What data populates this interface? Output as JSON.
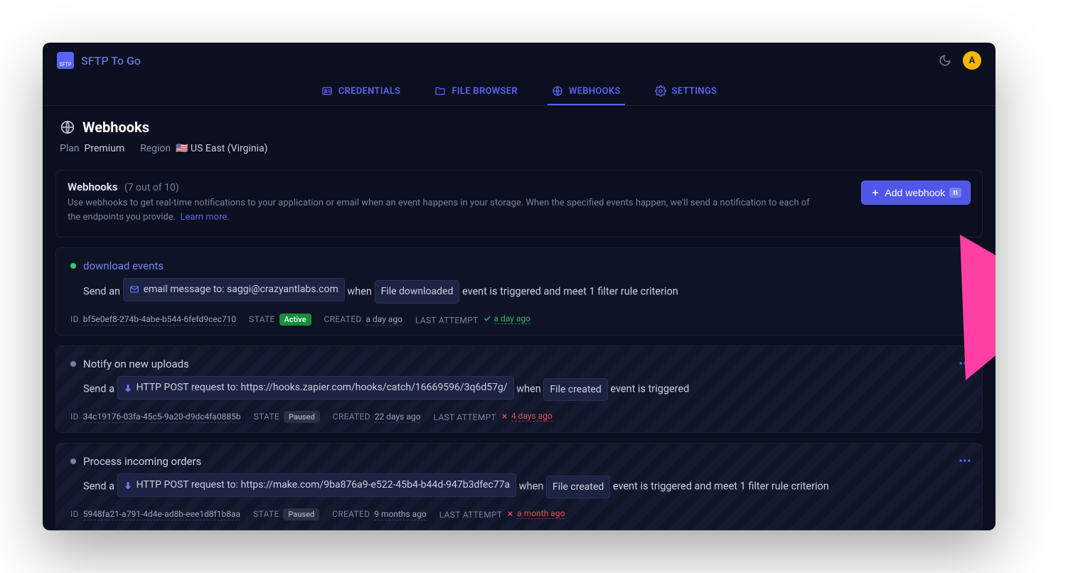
{
  "brand": {
    "logo_text": "SFTP",
    "title": "SFTP To Go"
  },
  "avatar_letter": "A",
  "tabs": {
    "credentials": "CREDENTIALS",
    "file_browser": "FILE BROWSER",
    "webhooks": "WEBHOOKS",
    "settings": "SETTINGS"
  },
  "page": {
    "title": "Webhooks",
    "plan_label": "Plan",
    "plan_value": "Premium",
    "region_label": "Region",
    "region_value": "US East (Virginia)"
  },
  "section": {
    "title": "Webhooks",
    "count": "(7 out of 10)",
    "desc": "Use webhooks to get real-time notifications to your application or email when an event happens in your storage. When the specified events happen, we'll send a notification to each of the endpoints you provide.",
    "learn_more": "Learn more",
    "add_label": "Add webhook",
    "kbd": "n"
  },
  "items": [
    {
      "status": "green",
      "name": "download events",
      "name_style": "link",
      "send_prefix": "Send an",
      "action_label": "email message to: saggi@crazyantlabs.com",
      "action_icon": "mail",
      "when": "when",
      "event": "File downloaded",
      "suffix": "event is triggered and meet 1 filter rule criterion",
      "id": "bf5e0ef8-274b-4abe-b544-6fefd9cec710",
      "state": "Active",
      "state_class": "active",
      "created": "a day ago",
      "attempt_status": "ok",
      "attempt_text": "a day ago",
      "striped": false,
      "show_menu": false
    },
    {
      "status": "gray",
      "name": "Notify on new uploads",
      "name_style": "gray",
      "send_prefix": "Send a",
      "action_label": "HTTP POST request to: https://hooks.zapier.com/hooks/catch/16669596/3q6d57g/",
      "action_icon": "post",
      "when": "when",
      "event": "File created",
      "suffix": "event is triggered",
      "id": "34c19176-03fa-45c5-9a20-d9dc4fa0885b",
      "state": "Paused",
      "state_class": "paused",
      "created": "22 days ago",
      "attempt_status": "fail",
      "attempt_text": "4 days ago",
      "striped": true,
      "show_menu": true
    },
    {
      "status": "gray",
      "name": "Process incoming orders",
      "name_style": "gray",
      "send_prefix": "Send a",
      "action_label": "HTTP POST request to: https://make.com/9ba876a9-e522-45b4-b44d-947b3dfec77a",
      "action_icon": "post",
      "when": "when",
      "event": "File created",
      "suffix": "event is triggered and meet 1 filter rule criterion",
      "id": "5948fa21-a791-4d4e-ad8b-eee1d8f1b8aa",
      "state": "Paused",
      "state_class": "paused",
      "created": "9 months ago",
      "attempt_status": "fail",
      "attempt_text": "a month ago",
      "striped": true,
      "show_menu": true
    }
  ],
  "labels": {
    "id": "ID",
    "state": "STATE",
    "created": "CREATED",
    "last_attempt": "LAST ATTEMPT"
  }
}
